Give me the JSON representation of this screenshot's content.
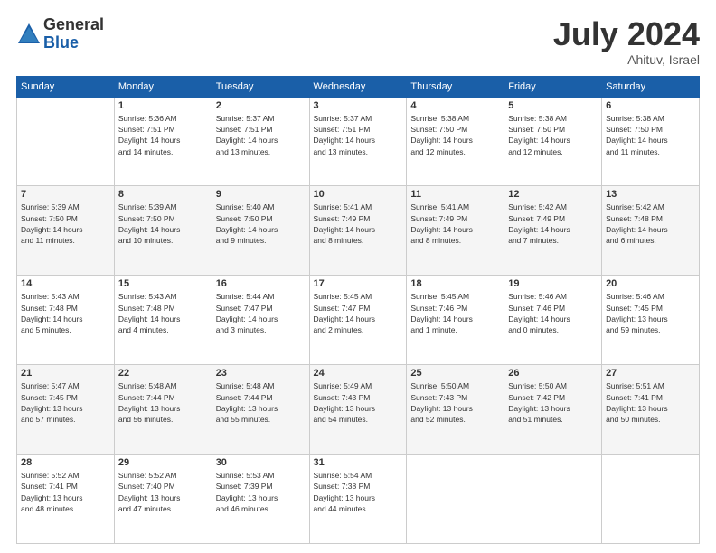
{
  "header": {
    "logo_general": "General",
    "logo_blue": "Blue",
    "month_year": "July 2024",
    "location": "Ahituv, Israel"
  },
  "days_of_week": [
    "Sunday",
    "Monday",
    "Tuesday",
    "Wednesday",
    "Thursday",
    "Friday",
    "Saturday"
  ],
  "weeks": [
    [
      {
        "day": "",
        "info": ""
      },
      {
        "day": "1",
        "info": "Sunrise: 5:36 AM\nSunset: 7:51 PM\nDaylight: 14 hours\nand 14 minutes."
      },
      {
        "day": "2",
        "info": "Sunrise: 5:37 AM\nSunset: 7:51 PM\nDaylight: 14 hours\nand 13 minutes."
      },
      {
        "day": "3",
        "info": "Sunrise: 5:37 AM\nSunset: 7:51 PM\nDaylight: 14 hours\nand 13 minutes."
      },
      {
        "day": "4",
        "info": "Sunrise: 5:38 AM\nSunset: 7:50 PM\nDaylight: 14 hours\nand 12 minutes."
      },
      {
        "day": "5",
        "info": "Sunrise: 5:38 AM\nSunset: 7:50 PM\nDaylight: 14 hours\nand 12 minutes."
      },
      {
        "day": "6",
        "info": "Sunrise: 5:38 AM\nSunset: 7:50 PM\nDaylight: 14 hours\nand 11 minutes."
      }
    ],
    [
      {
        "day": "7",
        "info": "Sunrise: 5:39 AM\nSunset: 7:50 PM\nDaylight: 14 hours\nand 11 minutes."
      },
      {
        "day": "8",
        "info": "Sunrise: 5:39 AM\nSunset: 7:50 PM\nDaylight: 14 hours\nand 10 minutes."
      },
      {
        "day": "9",
        "info": "Sunrise: 5:40 AM\nSunset: 7:50 PM\nDaylight: 14 hours\nand 9 minutes."
      },
      {
        "day": "10",
        "info": "Sunrise: 5:41 AM\nSunset: 7:49 PM\nDaylight: 14 hours\nand 8 minutes."
      },
      {
        "day": "11",
        "info": "Sunrise: 5:41 AM\nSunset: 7:49 PM\nDaylight: 14 hours\nand 8 minutes."
      },
      {
        "day": "12",
        "info": "Sunrise: 5:42 AM\nSunset: 7:49 PM\nDaylight: 14 hours\nand 7 minutes."
      },
      {
        "day": "13",
        "info": "Sunrise: 5:42 AM\nSunset: 7:48 PM\nDaylight: 14 hours\nand 6 minutes."
      }
    ],
    [
      {
        "day": "14",
        "info": "Sunrise: 5:43 AM\nSunset: 7:48 PM\nDaylight: 14 hours\nand 5 minutes."
      },
      {
        "day": "15",
        "info": "Sunrise: 5:43 AM\nSunset: 7:48 PM\nDaylight: 14 hours\nand 4 minutes."
      },
      {
        "day": "16",
        "info": "Sunrise: 5:44 AM\nSunset: 7:47 PM\nDaylight: 14 hours\nand 3 minutes."
      },
      {
        "day": "17",
        "info": "Sunrise: 5:45 AM\nSunset: 7:47 PM\nDaylight: 14 hours\nand 2 minutes."
      },
      {
        "day": "18",
        "info": "Sunrise: 5:45 AM\nSunset: 7:46 PM\nDaylight: 14 hours\nand 1 minute."
      },
      {
        "day": "19",
        "info": "Sunrise: 5:46 AM\nSunset: 7:46 PM\nDaylight: 14 hours\nand 0 minutes."
      },
      {
        "day": "20",
        "info": "Sunrise: 5:46 AM\nSunset: 7:45 PM\nDaylight: 13 hours\nand 59 minutes."
      }
    ],
    [
      {
        "day": "21",
        "info": "Sunrise: 5:47 AM\nSunset: 7:45 PM\nDaylight: 13 hours\nand 57 minutes."
      },
      {
        "day": "22",
        "info": "Sunrise: 5:48 AM\nSunset: 7:44 PM\nDaylight: 13 hours\nand 56 minutes."
      },
      {
        "day": "23",
        "info": "Sunrise: 5:48 AM\nSunset: 7:44 PM\nDaylight: 13 hours\nand 55 minutes."
      },
      {
        "day": "24",
        "info": "Sunrise: 5:49 AM\nSunset: 7:43 PM\nDaylight: 13 hours\nand 54 minutes."
      },
      {
        "day": "25",
        "info": "Sunrise: 5:50 AM\nSunset: 7:43 PM\nDaylight: 13 hours\nand 52 minutes."
      },
      {
        "day": "26",
        "info": "Sunrise: 5:50 AM\nSunset: 7:42 PM\nDaylight: 13 hours\nand 51 minutes."
      },
      {
        "day": "27",
        "info": "Sunrise: 5:51 AM\nSunset: 7:41 PM\nDaylight: 13 hours\nand 50 minutes."
      }
    ],
    [
      {
        "day": "28",
        "info": "Sunrise: 5:52 AM\nSunset: 7:41 PM\nDaylight: 13 hours\nand 48 minutes."
      },
      {
        "day": "29",
        "info": "Sunrise: 5:52 AM\nSunset: 7:40 PM\nDaylight: 13 hours\nand 47 minutes."
      },
      {
        "day": "30",
        "info": "Sunrise: 5:53 AM\nSunset: 7:39 PM\nDaylight: 13 hours\nand 46 minutes."
      },
      {
        "day": "31",
        "info": "Sunrise: 5:54 AM\nSunset: 7:38 PM\nDaylight: 13 hours\nand 44 minutes."
      },
      {
        "day": "",
        "info": ""
      },
      {
        "day": "",
        "info": ""
      },
      {
        "day": "",
        "info": ""
      }
    ]
  ]
}
